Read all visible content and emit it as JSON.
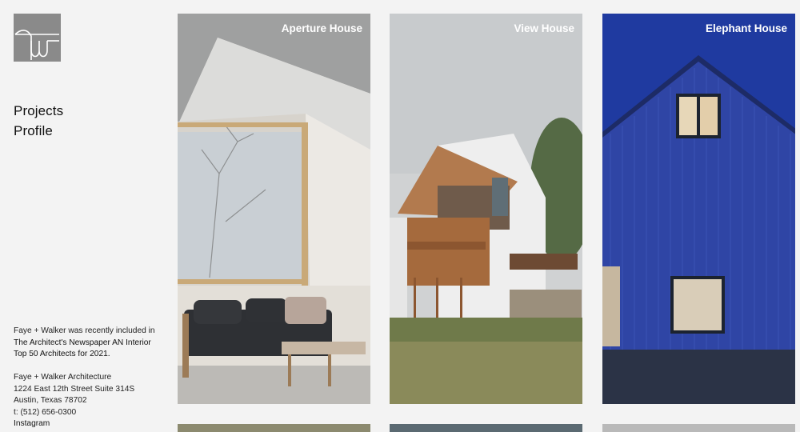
{
  "brand": {
    "logo_icon": "faye-walker-monogram-icon"
  },
  "nav": {
    "items": [
      {
        "label": "Projects"
      },
      {
        "label": "Profile"
      }
    ]
  },
  "info": {
    "news_intro": "Faye + Walker was recently included in",
    "news_link_line1": "The Architect's Newspaper AN Interior",
    "news_link_line2": "Top 50 Architects for 2021.",
    "firm_name": "Faye + Walker Architecture",
    "address_line1": "1224 East 12th Street Suite 314S",
    "address_line2": "Austin, Texas 78702",
    "phone": "t: (512) 656-0300",
    "instagram": "Instagram"
  },
  "projects": [
    {
      "title": "Aperture House"
    },
    {
      "title": "View House"
    },
    {
      "title": "Elephant House"
    }
  ]
}
